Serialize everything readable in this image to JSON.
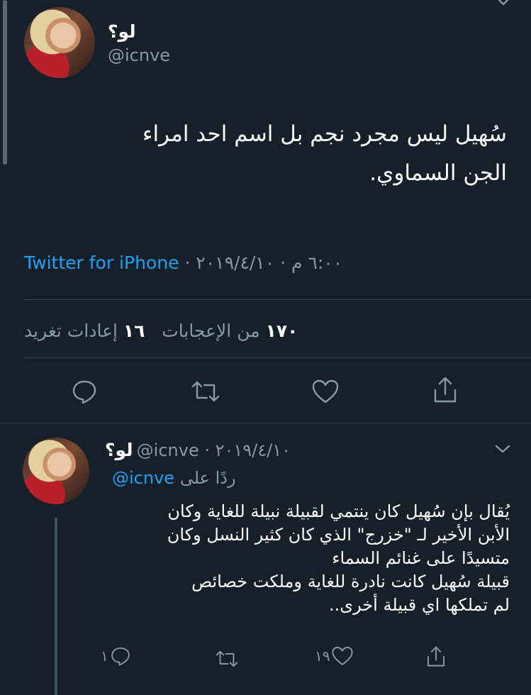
{
  "main_tweet": {
    "display_name": "لو؟",
    "handle": "@icnve",
    "text_line1": "سُهيل ليس مجرد نجم بل اسم احد امراء",
    "text_line2": "الجن السماوي.",
    "source_app": "Twitter for iPhone",
    "timestamp": "٦:٠٠ م · ٢٠١٩/٤/١٠ ·",
    "likes_count": "١٧٠",
    "likes_label": "من الإعجابات",
    "retweets_count": "١٦",
    "retweets_label": "إعادات تغريد"
  },
  "reply_tweet": {
    "display_name": "لو؟",
    "handle_date": "@icnve · ٢٠١٩/٤/١٠",
    "replying_to_label": "ردًا على",
    "replying_to_handle": "@icnve",
    "lines": [
      "يُقال بإن سُهيل كان ينتمي لقبيلة نبيلة للغاية وكان",
      "الأبن الأخير لـ \"خزرج\" الذي كان كثير النسل وكان",
      "متسيدًا على غنائم السماء",
      "قبيلة سُهيل كانت نادرة للغاية وملكت خصائص",
      "لم تملكها اي قبيلة أخرى.."
    ],
    "reply_count": "١",
    "like_count": "١٩"
  },
  "icons": {
    "reply": "reply-icon",
    "retweet": "retweet-icon",
    "like": "heart-icon",
    "share": "share-icon",
    "more": "chevron-down-icon"
  }
}
